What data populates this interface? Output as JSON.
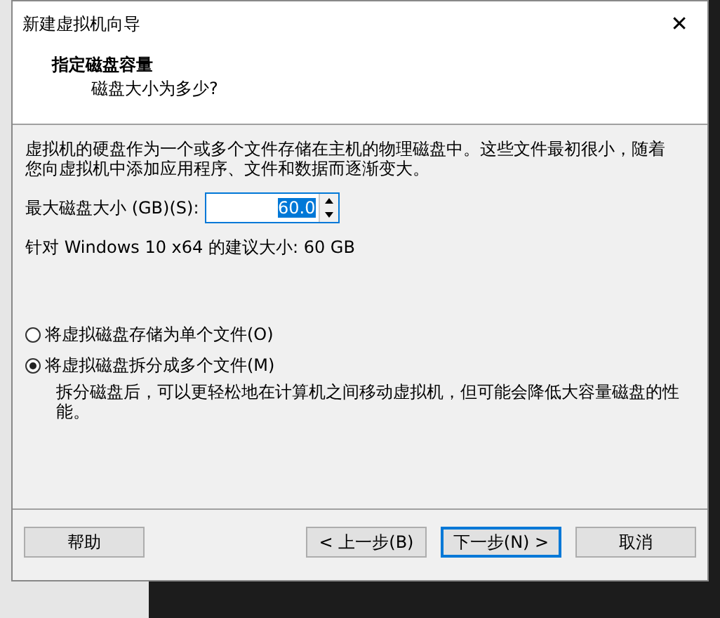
{
  "window": {
    "title": "新建虚拟机向导",
    "close": "✕"
  },
  "header": {
    "title": "指定磁盘容量",
    "subtitle": "磁盘大小为多少?"
  },
  "description": "虚拟机的硬盘作为一个或多个文件存储在主机的物理磁盘中。这些文件最初很小，随着您向虚拟机中添加应用程序、文件和数据而逐渐变大。",
  "disk_size": {
    "label": "最大磁盘大小 (GB)(S):",
    "value": "60.0",
    "value_selected": true,
    "focused": true
  },
  "recommendation": "针对 Windows 10 x64 的建议大小: 60 GB",
  "options": [
    {
      "label": "将虚拟磁盘存储为单个文件(O)",
      "selected": false
    },
    {
      "label": "将虚拟磁盘拆分成多个文件(M)",
      "selected": true,
      "note": "拆分磁盘后，可以更轻松地在计算机之间移动虚拟机，但可能会降低大容量磁盘的性能。"
    }
  ],
  "buttons": [
    {
      "label": "帮助",
      "kind": "help",
      "default": false
    },
    {
      "label": "< 上一步(B)",
      "kind": "nav",
      "default": false
    },
    {
      "label": "下一步(N) >",
      "kind": "nav",
      "default": true
    },
    {
      "label": "取消",
      "kind": "nav",
      "default": false
    }
  ]
}
